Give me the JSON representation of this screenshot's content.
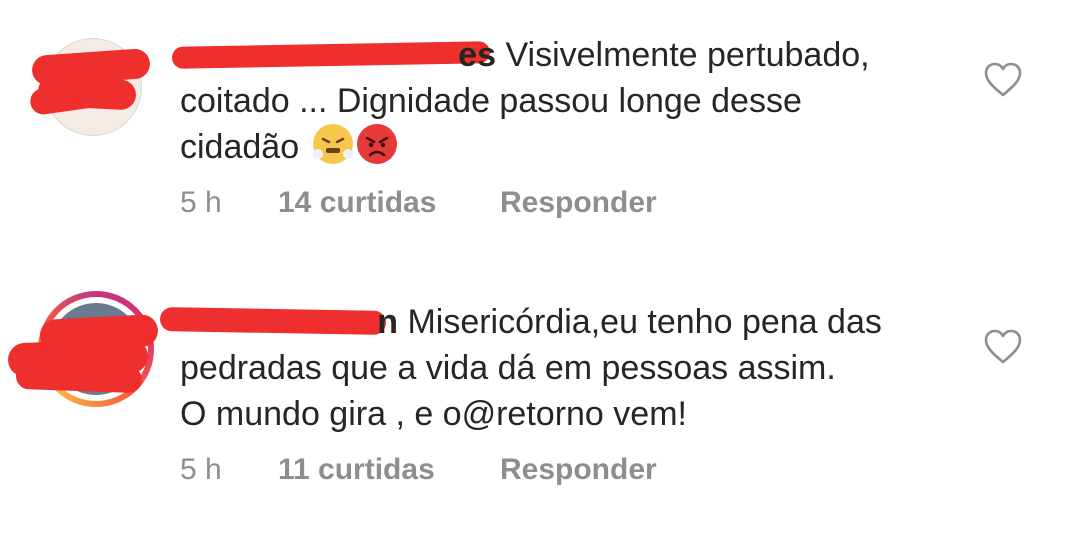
{
  "comments": [
    {
      "username": "es",
      "text_line1": " Visivelmente pertubado,",
      "text_line2": "coitado ... Dignidade passou longe desse",
      "text_line3": "cidadão",
      "emojis": [
        "steam-face-emoji",
        "angry-face-emoji"
      ],
      "time": "5 h",
      "likes": "14 curtidas",
      "reply": "Responder",
      "icon": "heart-outline-icon"
    },
    {
      "username": "n",
      "text_line1": " Misericórdia,eu tenho pena das",
      "text_line2": "pedradas que a vida dá em pessoas assim.",
      "text_line3": "O mundo gira , e o@retorno vem!",
      "time": "5 h",
      "likes": "11 curtidas",
      "reply": "Responder",
      "icon": "heart-outline-icon"
    }
  ],
  "colors": {
    "text": "#262626",
    "meta": "#8e8e8e",
    "redaction": "#ef2e2e",
    "story_ring": "#e1306c"
  }
}
